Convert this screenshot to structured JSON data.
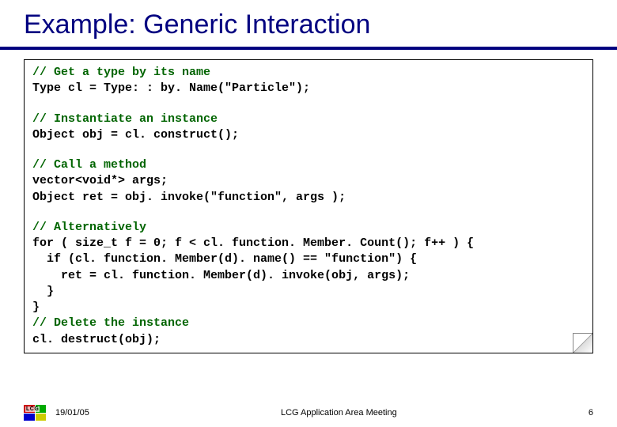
{
  "title": "Example: Generic Interaction",
  "code": {
    "c1": "// Get a type by its name",
    "l1": "Type cl = Type: : by. Name(\"Particle\");",
    "c2": "// Instantiate an instance",
    "l2": "Object obj = cl. construct();",
    "c3": "// Call a method",
    "l3": "vector<void*> args;",
    "l4": "Object ret = obj. invoke(\"function\", args );",
    "c4": "// Alternatively",
    "l5": "for ( size_t f = 0; f < cl. function. Member. Count(); f++ ) {",
    "l6": "  if (cl. function. Member(d). name() == \"function\") {",
    "l7": "    ret = cl. function. Member(d). invoke(obj, args);",
    "l8": "  }",
    "l9": "}",
    "c5": "// Delete the instance",
    "l10": "cl. destruct(obj);"
  },
  "footer": {
    "logo_text": "LCG",
    "date": "19/01/05",
    "center": "LCG Application Area Meeting",
    "page": "6"
  }
}
